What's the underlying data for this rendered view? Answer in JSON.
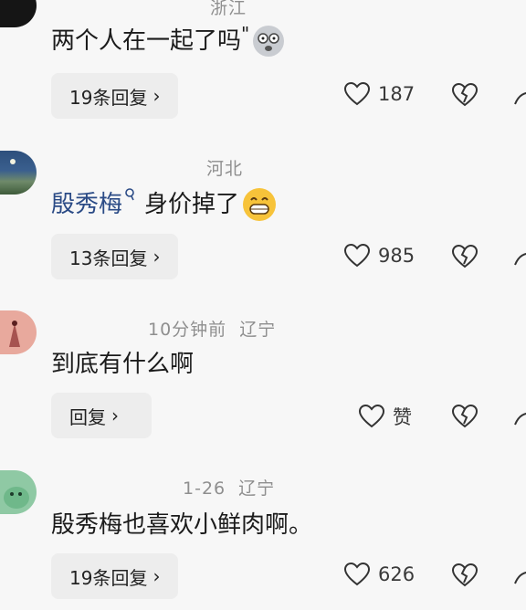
{
  "comments": [
    {
      "location": "浙江",
      "time": "",
      "text": "两个人在一起了吗",
      "reply_label": "19条回复",
      "like_count": "187"
    },
    {
      "location": "河北",
      "time": "",
      "username": "殷秀梅",
      "text": "身价掉了",
      "reply_label": "13条回复",
      "like_count": "985"
    },
    {
      "location": "辽宁",
      "time": "10分钟前",
      "text": "到底有什么啊",
      "reply_label": "回复",
      "like_count": "赞"
    },
    {
      "location": "辽宁",
      "time": "1-26",
      "text": "殷秀梅也喜欢小鲜肉啊。",
      "reply_label": "19条回复",
      "like_count": "626"
    }
  ],
  "icons": {
    "like": "heart-outline-icon",
    "dislike": "broken-heart-icon",
    "share": "share-icon",
    "chevron": "chevron-right-icon"
  },
  "colors": {
    "username": "#2b4b86",
    "meta": "#8f8f8f",
    "reply_bg": "#ededed"
  }
}
